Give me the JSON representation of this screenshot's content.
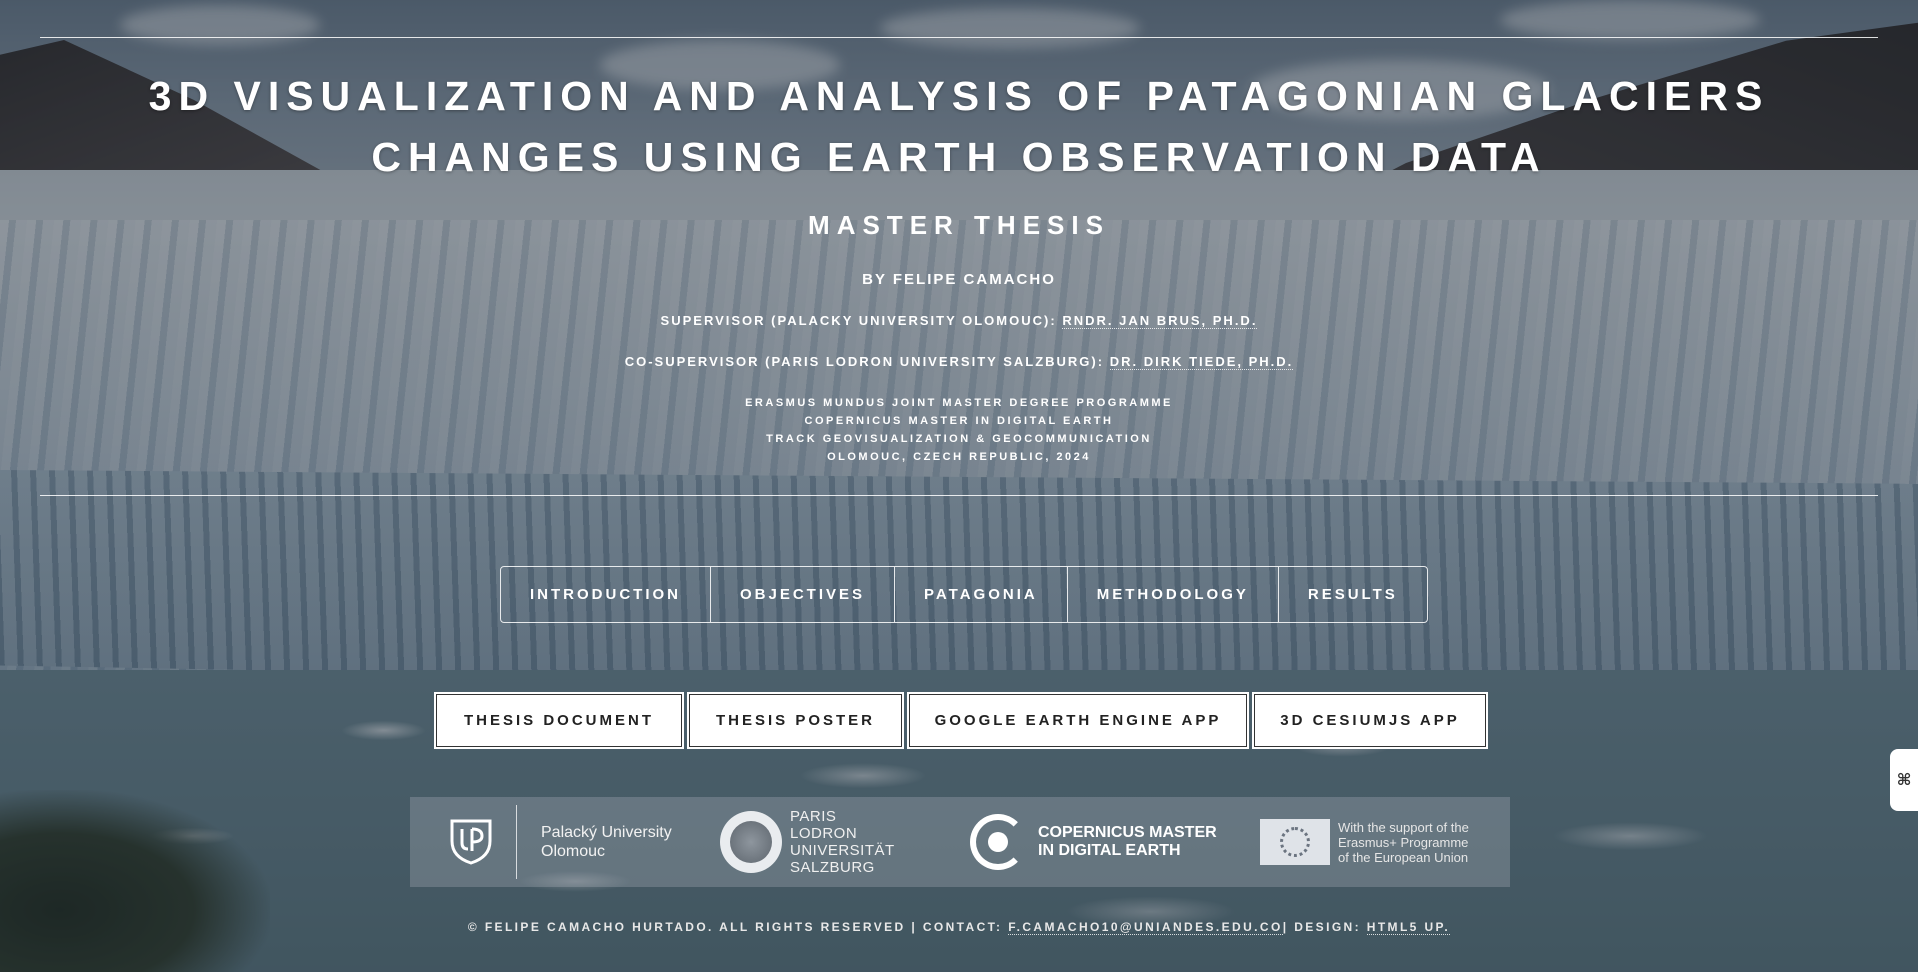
{
  "header": {
    "title_lines": [
      "3D VISUALIZATION AND ANALYSIS OF PATAGONIAN GLACIERS",
      "CHANGES USING EARTH OBSERVATION DATA"
    ],
    "subtitle": "MASTER THESIS",
    "author": "BY FELIPE CAMACHO",
    "supervisor_label": "SUPERVISOR (PALACKY UNIVERSITY OLOMOUC):",
    "supervisor_name": "RNDR. JAN BRUS, PH.D.",
    "cosupervisor_label": "CO-SUPERVISOR (PARIS LODRON UNIVERSITY SALZBURG):",
    "cosupervisor_name": "DR. DIRK TIEDE, PH.D.",
    "programme_lines": [
      "ERASMUS MUNDUS JOINT MASTER DEGREE PROGRAMME",
      "COPERNICUS MASTER IN DIGITAL EARTH",
      "TRACK GEOVISUALIZATION & GEOCOMMUNICATION",
      "OLOMOUC, CZECH REPUBLIC, 2024"
    ]
  },
  "nav": {
    "items": [
      "INTRODUCTION",
      "OBJECTIVES",
      "PATAGONIA",
      "METHODOLOGY",
      "RESULTS"
    ]
  },
  "resources": {
    "items": [
      "THESIS DOCUMENT",
      "THESIS POSTER",
      "GOOGLE EARTH ENGINE APP",
      "3D CESIUMJS APP"
    ]
  },
  "logos": {
    "upol_name_lines": [
      "Palacký University",
      "Olomouc"
    ],
    "plus_lines": [
      "PARIS",
      "LODRON",
      "UNIVERSITÄT",
      "SALZBURG"
    ],
    "copernicus_lines": [
      "COPERNICUS MASTER",
      "IN DIGITAL EARTH"
    ],
    "eu_lines": [
      "With the support of the",
      "Erasmus+ Programme",
      "of the European Union"
    ]
  },
  "footer": {
    "copyright": "© FELIPE CAMACHO HURTADO. ALL RIGHTS RESERVED | CONTACT:",
    "email": "F.CAMACHO10@UNIANDES.EDU.CO",
    "design_label": "| DESIGN:",
    "design_link": "HTML5 UP."
  },
  "sidetab": {
    "label": "⌘"
  },
  "colors": {
    "text": "#ffffff",
    "button_bg": "#ffffff",
    "button_text": "#222222"
  }
}
